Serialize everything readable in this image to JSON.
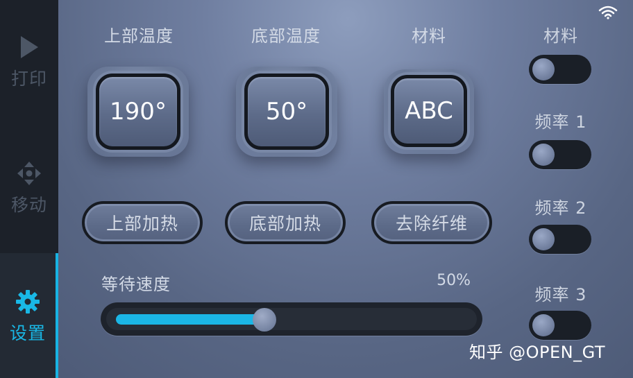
{
  "sidebar": {
    "items": [
      {
        "label": "打印",
        "icon": "play-icon",
        "active": false
      },
      {
        "label": "移动",
        "icon": "move-arrows-icon",
        "active": false
      },
      {
        "label": "设置",
        "icon": "gear-icon",
        "active": true
      }
    ]
  },
  "status_bar": {
    "wifi_icon": "wifi-icon"
  },
  "temperature": {
    "top": {
      "title": "上部温度",
      "value": "190°"
    },
    "bottom": {
      "title": "底部温度",
      "value": "50°"
    },
    "material": {
      "title": "材料",
      "value": "ABC"
    }
  },
  "actions": {
    "top_heat": "上部加热",
    "bottom_heat": "底部加热",
    "remove_fiber": "去除纤维"
  },
  "slider": {
    "label": "等待速度",
    "value_text": "50%",
    "level": 0.42
  },
  "toggles": [
    {
      "label": "材料",
      "on": false
    },
    {
      "label": "频率 1",
      "on": false
    },
    {
      "label": "频率 2",
      "on": false
    },
    {
      "label": "频率 3",
      "on": false
    }
  ],
  "watermark": "知乎 @OPEN_GT",
  "colors": {
    "accent": "#1bb6e6",
    "sidebar_bg": "#1c2129"
  }
}
